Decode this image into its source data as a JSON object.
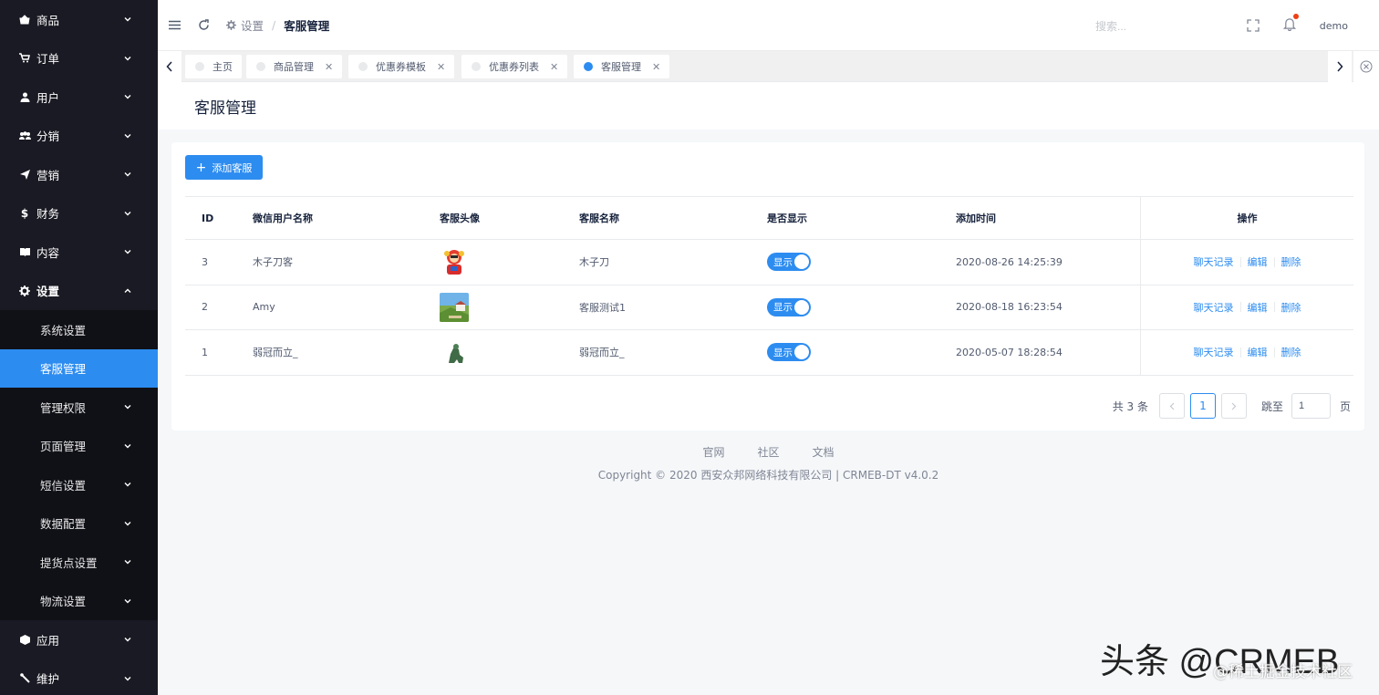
{
  "sidebar": {
    "items": [
      {
        "label": "商品",
        "icon": "shop-icon"
      },
      {
        "label": "订单",
        "icon": "cart-icon"
      },
      {
        "label": "用户",
        "icon": "user-icon"
      },
      {
        "label": "分销",
        "icon": "users-icon"
      },
      {
        "label": "营销",
        "icon": "send-icon"
      },
      {
        "label": "财务",
        "icon": "dollar-icon"
      },
      {
        "label": "内容",
        "icon": "book-icon"
      },
      {
        "label": "设置",
        "icon": "gear-icon"
      }
    ],
    "settings_children": [
      {
        "label": "系统设置"
      },
      {
        "label": "客服管理"
      },
      {
        "label": "管理权限"
      },
      {
        "label": "页面管理"
      },
      {
        "label": "短信设置"
      },
      {
        "label": "数据配置"
      },
      {
        "label": "提货点设置"
      },
      {
        "label": "物流设置"
      }
    ],
    "bottom_items": [
      {
        "label": "应用",
        "icon": "cube-icon"
      },
      {
        "label": "维护",
        "icon": "wrench-icon"
      }
    ]
  },
  "header": {
    "breadcrumb_parent": "设置",
    "breadcrumb_separator": "/",
    "breadcrumb_current": "客服管理",
    "search_placeholder": "搜索...",
    "username": "demo"
  },
  "tabs": [
    {
      "label": "主页"
    },
    {
      "label": "商品管理"
    },
    {
      "label": "优惠券模板"
    },
    {
      "label": "优惠券列表"
    },
    {
      "label": "客服管理"
    }
  ],
  "page": {
    "title": "客服管理",
    "add_button": "添加客服"
  },
  "table": {
    "headers": [
      "ID",
      "微信用户名称",
      "客服头像",
      "客服名称",
      "是否显示",
      "添加时间",
      "操作"
    ],
    "rows": [
      {
        "id": "3",
        "wechat_name": "木子刀客",
        "name": "木子刀",
        "show": "显示",
        "time": "2020-08-26 14:25:39"
      },
      {
        "id": "2",
        "wechat_name": "Amy",
        "name": "客服测试1",
        "show": "显示",
        "time": "2020-08-18 16:23:54"
      },
      {
        "id": "1",
        "wechat_name": "弱冠而立_",
        "name": "弱冠而立_",
        "show": "显示",
        "time": "2020-05-07 18:28:54"
      }
    ],
    "actions": {
      "chat": "聊天记录",
      "edit": "编辑",
      "delete": "删除"
    }
  },
  "pagination": {
    "total": "共 3 条",
    "current_page": "1",
    "jump_label": "跳至",
    "jump_value": "1",
    "page_suffix": "页"
  },
  "footer": {
    "links": [
      "官网",
      "社区",
      "文档"
    ],
    "copyright": "Copyright © 2020 西安众邦网络科技有限公司 | CRMEB-DT v4.0.2"
  },
  "watermark": {
    "main": "头条 @CRMEB",
    "sub": "@稀土掘金技术社区"
  },
  "colors": {
    "primary": "#2d8cf0",
    "sidebar_bg": "#191a23",
    "submenu_bg": "#101117"
  }
}
